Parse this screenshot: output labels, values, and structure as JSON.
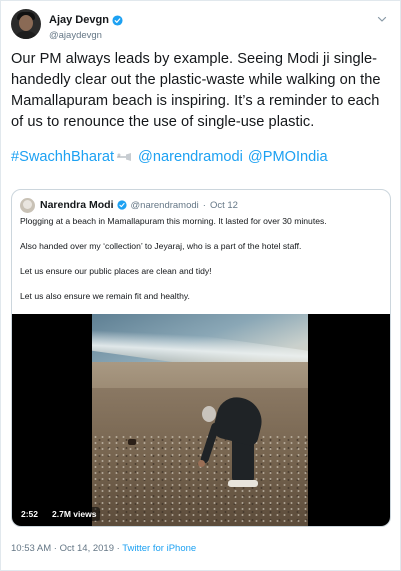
{
  "author": {
    "display_name": "Ajay Devgn",
    "handle": "@ajaydevgn",
    "verified": true,
    "avatar_icon": "profile-avatar"
  },
  "tweet": {
    "text": "Our PM always leads by example. Seeing Modi ji single-handedly clear out the plastic-waste while walking on the Mamallapuram beach is inspiring. It’s a reminder to each of us to renounce the use of single-use plastic.",
    "hashtag": "#SwachhBharat",
    "hashtag_emoji": "sweeping-broom-emoji",
    "mentions": [
      "@narendramodi",
      "@PMOIndia"
    ]
  },
  "quoted_tweet": {
    "display_name": "Narendra Modi",
    "handle": "@narendramodi",
    "separator": "·",
    "date": "Oct 12",
    "verified": true,
    "paragraphs": [
      "Plogging at a beach in Mamallapuram this morning. It lasted for over 30 minutes.",
      "Also handed over my ‘collection’ to Jeyaraj, who is a part of the hotel staff.",
      "Let us ensure our public places are clean and tidy!",
      "Let us also ensure we remain fit and healthy."
    ],
    "video": {
      "duration": "2:52",
      "views": "2.7M views"
    }
  },
  "meta": {
    "timestamp": "10:53 AM · Oct 14, 2019 · ",
    "source": "Twitter for iPhone"
  },
  "colors": {
    "link": "#1da1f2",
    "muted": "#657786",
    "verified_badge": "#1da1f2",
    "border": "#ccd6dd"
  }
}
